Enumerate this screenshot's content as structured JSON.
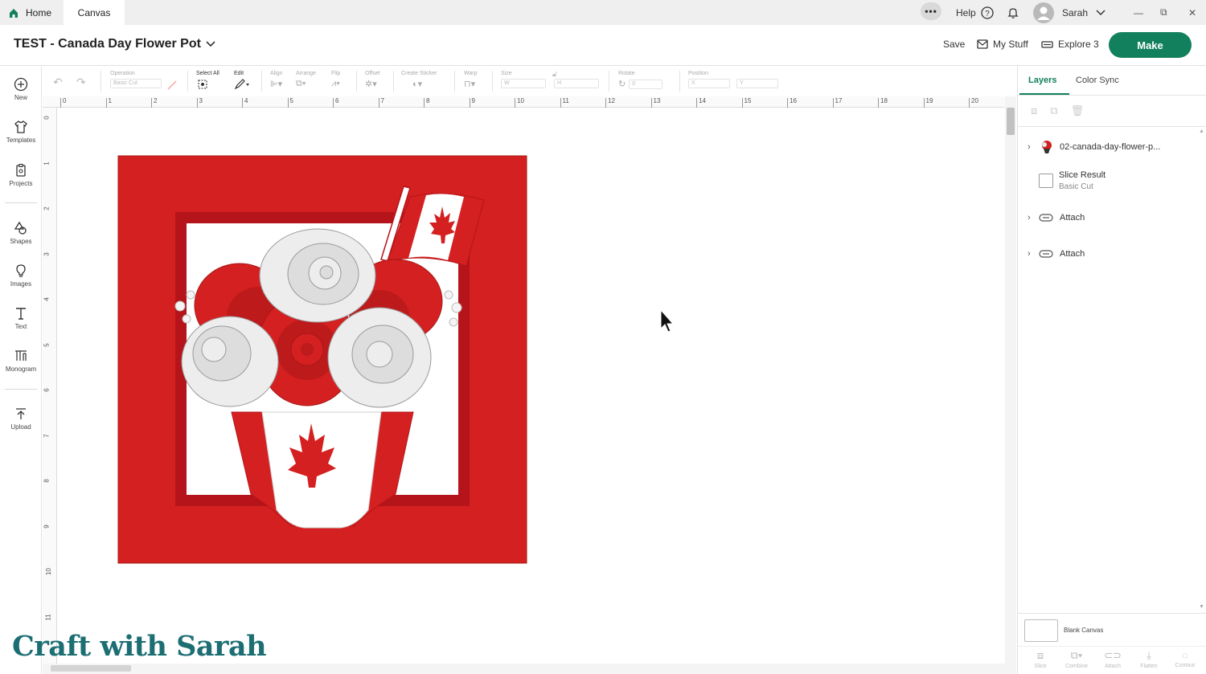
{
  "titlebar": {
    "tabs": [
      {
        "label": "Home"
      },
      {
        "label": "Canvas"
      }
    ],
    "help_label": "Help",
    "user_name": "Sarah"
  },
  "header": {
    "project_title": "TEST - Canada Day Flower Pot",
    "save_label": "Save",
    "mystuff_label": "My Stuff",
    "machine_label": "Explore 3",
    "make_label": "Make"
  },
  "sidebar": {
    "items": [
      {
        "label": "New",
        "icon": "plus-circle-icon"
      },
      {
        "label": "Templates",
        "icon": "shirt-icon"
      },
      {
        "label": "Projects",
        "icon": "clipboard-icon"
      },
      {
        "label": "Shapes",
        "icon": "shapes-icon"
      },
      {
        "label": "Images",
        "icon": "lightbulb-icon"
      },
      {
        "label": "Text",
        "icon": "text-icon"
      },
      {
        "label": "Monogram",
        "icon": "monogram-icon"
      },
      {
        "label": "Upload",
        "icon": "upload-icon"
      }
    ]
  },
  "toolbar": {
    "operation_label": "Operation",
    "operation_value": "Basic Cut",
    "select_all_label": "Select All",
    "edit_label": "Edit",
    "align_label": "Align",
    "arrange_label": "Arrange",
    "flip_label": "Flip",
    "offset_label": "Offset",
    "sticker_label": "Create Sticker",
    "warp_label": "Warp",
    "size_label": "Size",
    "size_w": "W",
    "size_h": "H",
    "rotate_label": "Rotate",
    "rotate_value": "0",
    "position_label": "Position",
    "pos_x": "X",
    "pos_y": "Y"
  },
  "rulers": {
    "top": [
      "0",
      "1",
      "2",
      "3",
      "4",
      "5",
      "6",
      "7",
      "8",
      "9",
      "10",
      "11",
      "12",
      "13",
      "14",
      "15",
      "16",
      "17",
      "18",
      "19",
      "20"
    ],
    "left": [
      "0",
      "1",
      "2",
      "3",
      "4",
      "5",
      "6",
      "7",
      "8",
      "9",
      "10",
      "11"
    ]
  },
  "layers_panel": {
    "tabs": [
      {
        "label": "Layers"
      },
      {
        "label": "Color Sync"
      }
    ],
    "layers": [
      {
        "name": "02-canada-day-flower-p...",
        "sub": ""
      },
      {
        "name": "Slice Result",
        "sub": "Basic Cut"
      },
      {
        "name": "Attach",
        "sub": ""
      },
      {
        "name": "Attach",
        "sub": ""
      }
    ],
    "blank_canvas_label": "Blank Canvas",
    "footer_tools": [
      {
        "label": "Slice"
      },
      {
        "label": "Combine"
      },
      {
        "label": "Attach"
      },
      {
        "label": "Flatten"
      },
      {
        "label": "Contour"
      }
    ]
  },
  "colors": {
    "accent": "#12805c",
    "design_red": "#d42020",
    "design_dark_red": "#b5141a",
    "rose_white": "#eeeeee",
    "watermark": "#1c6e73"
  },
  "watermark": {
    "text": "Craft with Sarah"
  }
}
